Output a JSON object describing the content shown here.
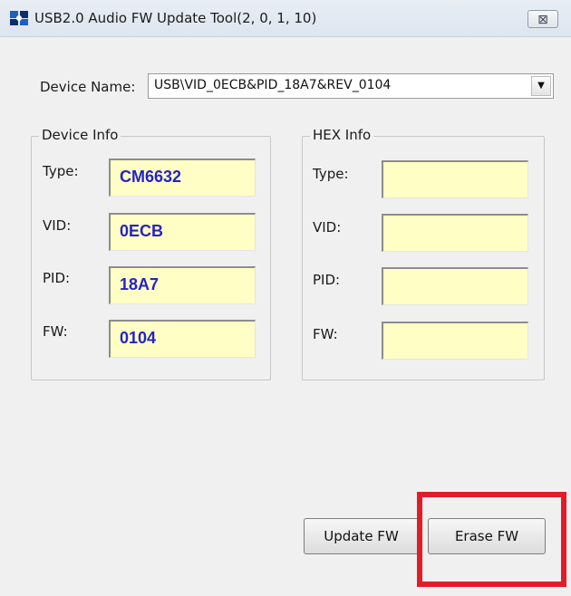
{
  "window": {
    "title": "USB2.0 Audio FW Update Tool(2, 0, 1, 10)",
    "close_glyph": "⊠",
    "app_icon": "usb-app-icon"
  },
  "device": {
    "label": "Device Name:",
    "selected": "USB\\VID_0ECB&PID_18A7&REV_0104",
    "dropdown_glyph": "▼"
  },
  "device_info": {
    "title": "Device Info",
    "fields": [
      {
        "label": "Type:",
        "value": "CM6632"
      },
      {
        "label": "VID:",
        "value": "0ECB"
      },
      {
        "label": "PID:",
        "value": "18A7"
      },
      {
        "label": "FW:",
        "value": "0104"
      }
    ]
  },
  "hex_info": {
    "title": "HEX Info",
    "fields": [
      {
        "label": "Type:",
        "value": ""
      },
      {
        "label": "VID:",
        "value": ""
      },
      {
        "label": "PID:",
        "value": ""
      },
      {
        "label": "FW:",
        "value": ""
      }
    ]
  },
  "buttons": {
    "update": "Update FW",
    "erase": "Erase FW"
  },
  "colors": {
    "field_bg": "#ffffc5",
    "value_text": "#2323c8",
    "highlight": "#e11d2a"
  }
}
